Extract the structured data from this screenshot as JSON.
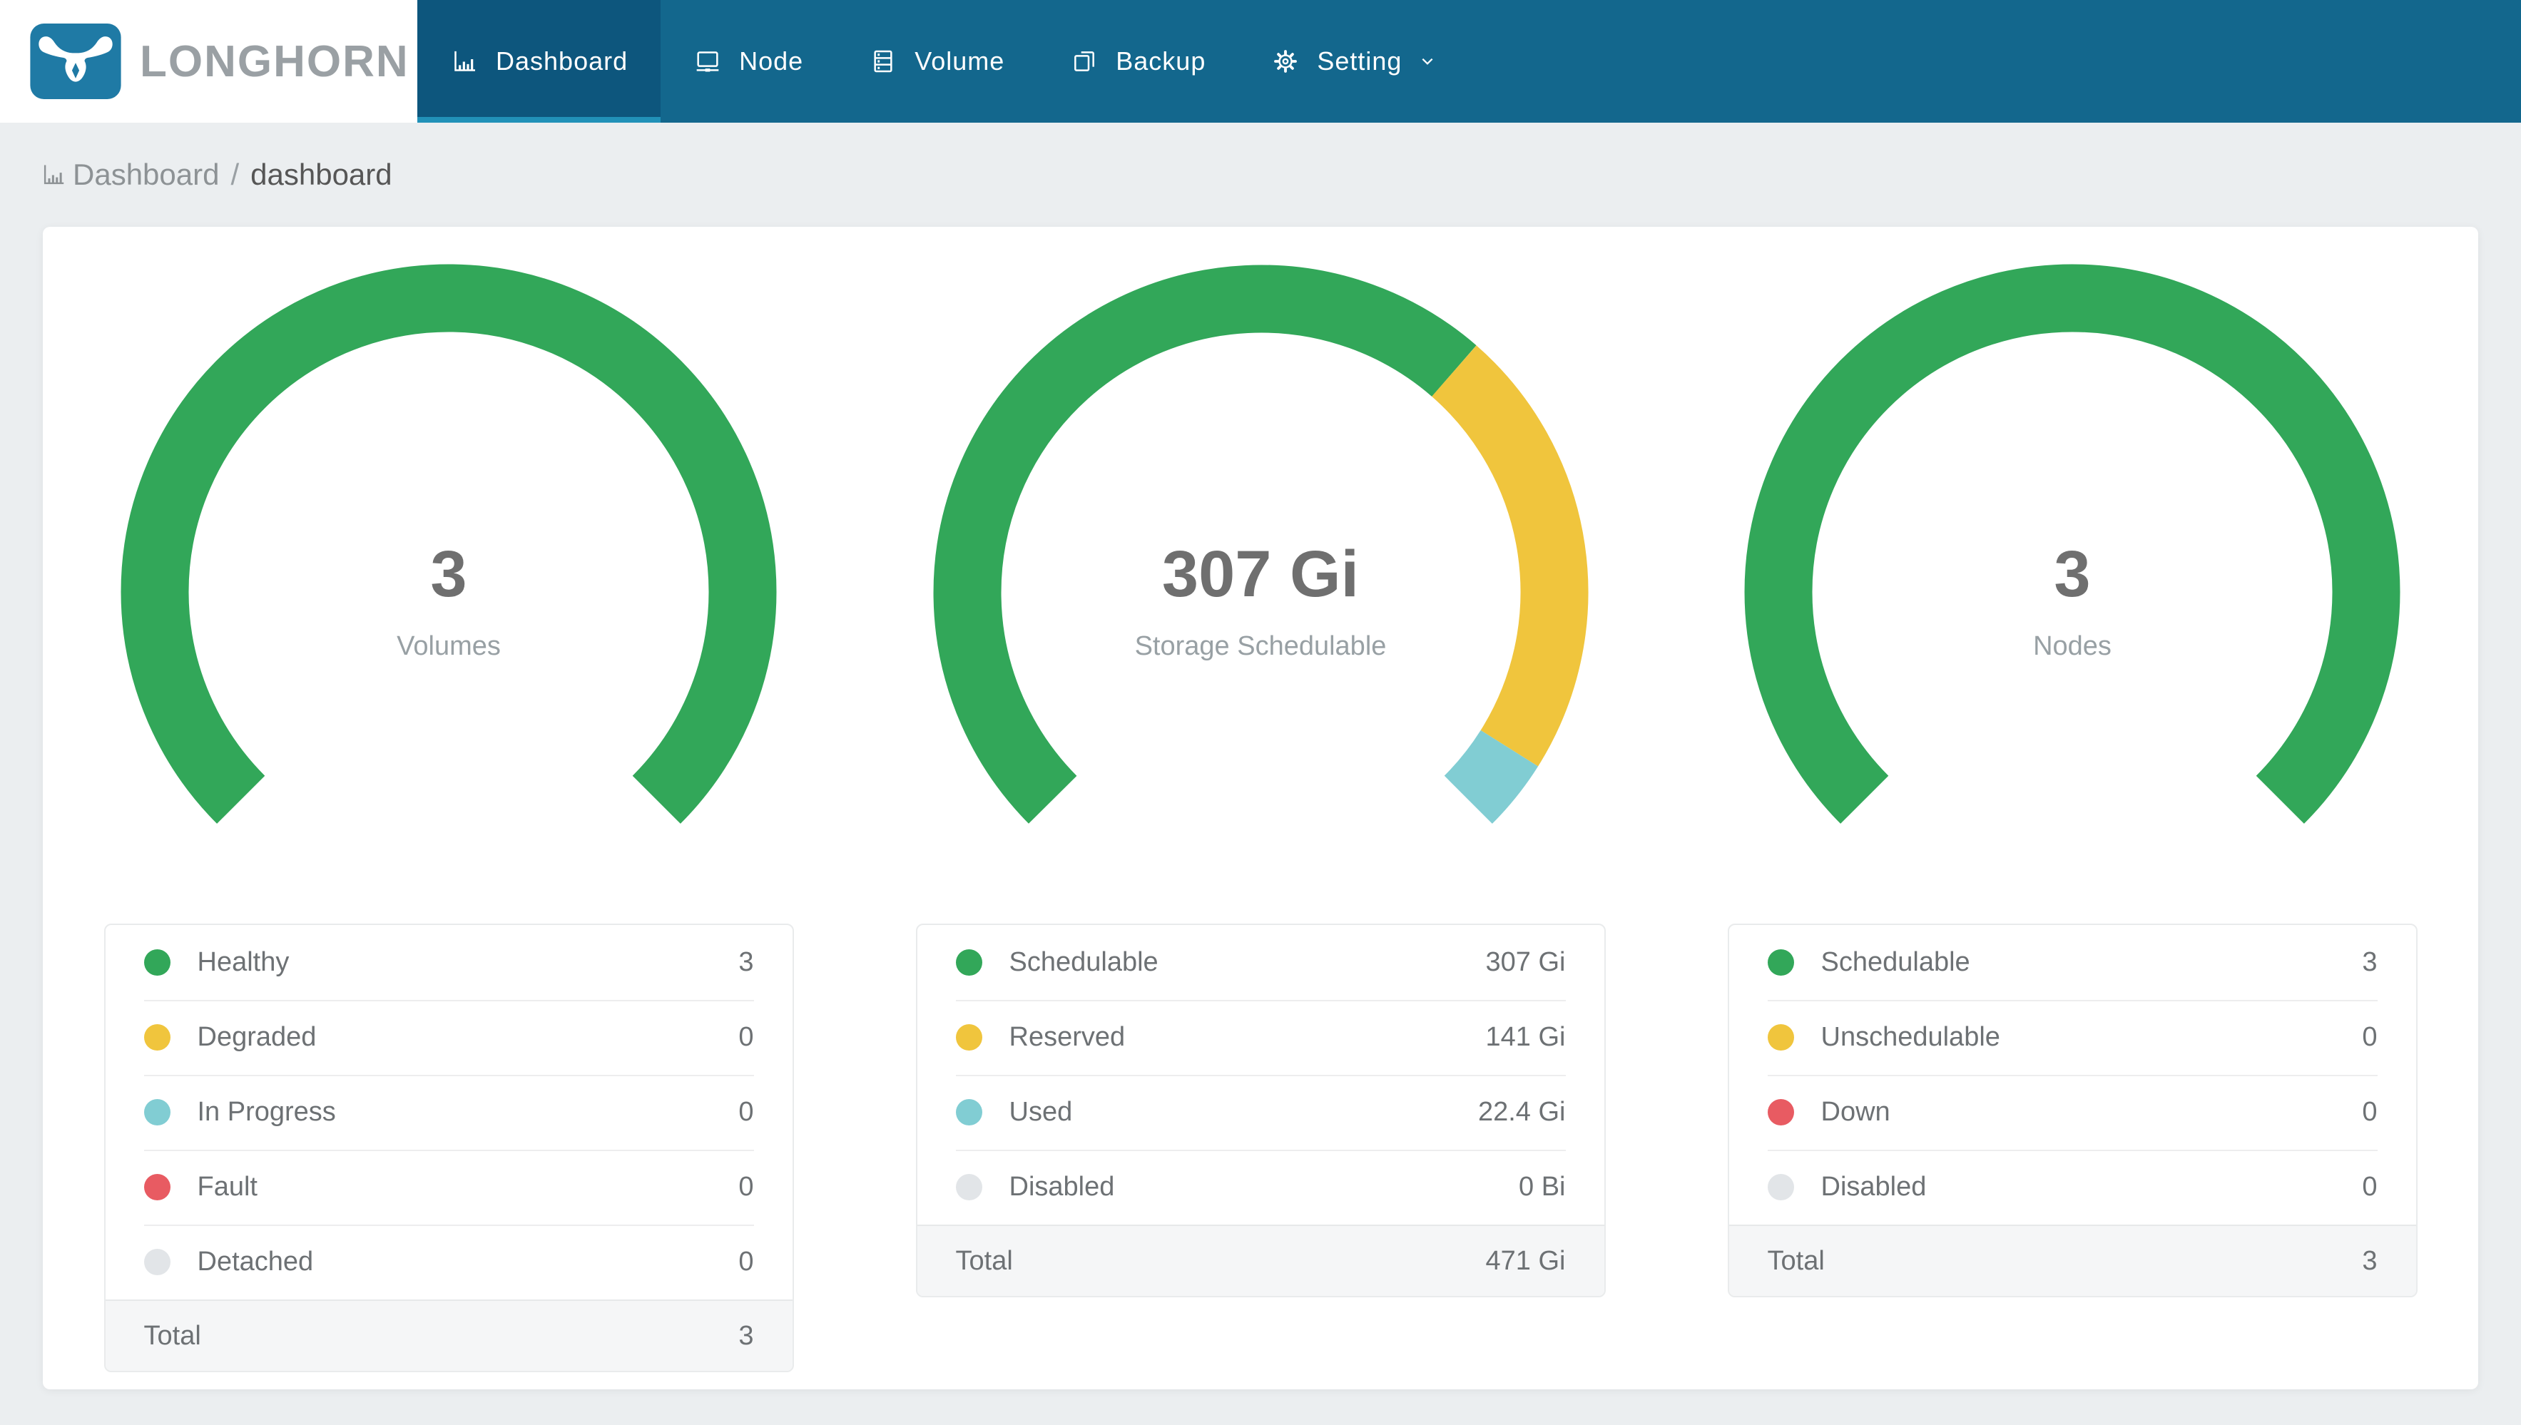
{
  "brand": {
    "name": "LONGHORN",
    "logo_icon": "longhorn-bull-icon",
    "logo_color": "#1f7aa5",
    "text_color": "#9aa0a4"
  },
  "nav": {
    "background": "#13678d",
    "active_background": "#0d567d",
    "active_underline": "#2191b8",
    "items": [
      {
        "label": "Dashboard",
        "icon": "bar-chart-icon",
        "active": true,
        "has_dropdown": false
      },
      {
        "label": "Node",
        "icon": "node-icon",
        "active": false,
        "has_dropdown": false
      },
      {
        "label": "Volume",
        "icon": "volume-icon",
        "active": false,
        "has_dropdown": false
      },
      {
        "label": "Backup",
        "icon": "backup-icon",
        "active": false,
        "has_dropdown": false
      },
      {
        "label": "Setting",
        "icon": "gear-icon",
        "active": false,
        "has_dropdown": true
      }
    ]
  },
  "breadcrumb": {
    "icon": "bar-chart-icon",
    "section": "Dashboard",
    "separator": "/",
    "page": "dashboard"
  },
  "colors": {
    "page_background": "#ebeef0",
    "status_green": "#32a759",
    "status_yellow": "#f0c53d",
    "status_teal": "#81cdd3",
    "status_red": "#e85b62",
    "status_gray": "#e2e5e8"
  },
  "chart_data": [
    {
      "type": "donut-gauge",
      "center_value": "3",
      "center_label": "Volumes",
      "arc_span_deg": 270,
      "segments": [
        {
          "label": "Healthy",
          "value": 3,
          "display": "3",
          "color": "#32a759"
        },
        {
          "label": "Degraded",
          "value": 0,
          "display": "0",
          "color": "#f0c53d"
        },
        {
          "label": "In Progress",
          "value": 0,
          "display": "0",
          "color": "#81cdd3"
        },
        {
          "label": "Fault",
          "value": 0,
          "display": "0",
          "color": "#e85b62"
        },
        {
          "label": "Detached",
          "value": 0,
          "display": "0",
          "color": "#e2e5e8"
        }
      ],
      "total": {
        "label": "Total",
        "value": 3,
        "display": "3"
      }
    },
    {
      "type": "donut-gauge",
      "center_value": "307 Gi",
      "center_label": "Storage Schedulable",
      "arc_span_deg": 270,
      "segments": [
        {
          "label": "Schedulable",
          "value": 307,
          "display": "307 Gi",
          "color": "#32a759"
        },
        {
          "label": "Reserved",
          "value": 141,
          "display": "141 Gi",
          "color": "#f0c53d"
        },
        {
          "label": "Used",
          "value": 22.4,
          "display": "22.4 Gi",
          "color": "#81cdd3"
        },
        {
          "label": "Disabled",
          "value": 0,
          "display": "0 Bi",
          "color": "#e2e5e8"
        }
      ],
      "total": {
        "label": "Total",
        "value": 470.4,
        "display": "471 Gi"
      }
    },
    {
      "type": "donut-gauge",
      "center_value": "3",
      "center_label": "Nodes",
      "arc_span_deg": 270,
      "segments": [
        {
          "label": "Schedulable",
          "value": 3,
          "display": "3",
          "color": "#32a759"
        },
        {
          "label": "Unschedulable",
          "value": 0,
          "display": "0",
          "color": "#f0c53d"
        },
        {
          "label": "Down",
          "value": 0,
          "display": "0",
          "color": "#e85b62"
        },
        {
          "label": "Disabled",
          "value": 0,
          "display": "0",
          "color": "#e2e5e8"
        }
      ],
      "total": {
        "label": "Total",
        "value": 3,
        "display": "3"
      }
    }
  ]
}
